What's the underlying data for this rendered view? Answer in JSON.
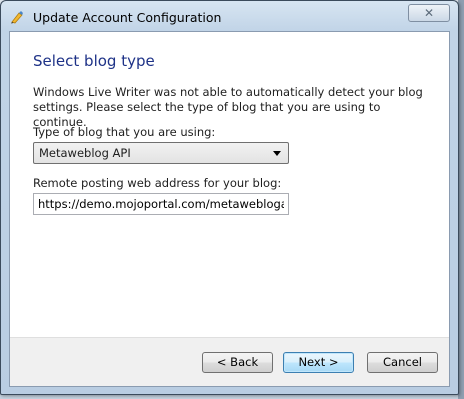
{
  "window": {
    "title": "Update Account Configuration",
    "close_glyph": "✕"
  },
  "page": {
    "heading": "Select blog type",
    "description": "Windows Live Writer was not able to automatically detect your blog settings. Please select the type of blog that you are using to continue."
  },
  "blog_type": {
    "label": "Type of blog that you are using:",
    "selected": "Metaweblog API"
  },
  "remote_address": {
    "label": "Remote posting web address for your blog:",
    "value": "https://demo.mojoportal.com/metaweblogapi."
  },
  "buttons": {
    "back": "< Back",
    "next": "Next >",
    "cancel": "Cancel"
  },
  "colors": {
    "heading": "#1e3287",
    "accent_border": "#3c7fb1"
  },
  "icons": {
    "app": "windows-live-writer-icon",
    "close": "close-icon",
    "dropdown": "chevron-down-icon"
  }
}
